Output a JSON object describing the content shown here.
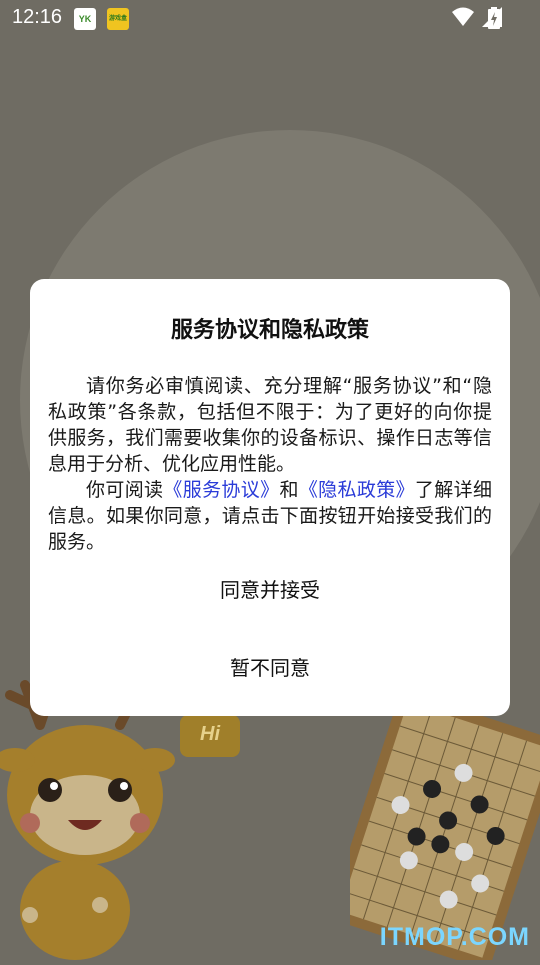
{
  "status_bar": {
    "time": "12:16",
    "app_icons": [
      {
        "name": "yk-app-icon",
        "label": "YK"
      },
      {
        "name": "game-app-icon",
        "label": "游戏盒"
      }
    ]
  },
  "dialog": {
    "title": "服务协议和隐私政策",
    "paragraph1": "请你务必审慎阅读、充分理解“服务协议”和“隐私政策”各条款，包括但不限于：为了更好的向你提供服务，我们需要收集你的设备标识、操作日志等信息用于分析、优化应用性能。",
    "p2_prefix": "你可阅读",
    "link_service": "《服务协议》",
    "p2_and": "和",
    "link_privacy": "《隐私政策》",
    "p2_suffix": "了解详细信息。如果你同意，请点击下面按钮开始接受我们的服务。",
    "agree_button": "同意并接受",
    "decline_button": "暂不同意"
  },
  "background": {
    "badge_text": "Hi",
    "watermark": "ITMOP.COM"
  },
  "colors": {
    "overlay": "#6f6c63",
    "link": "#2a3bd8",
    "watermark": "#7bd6ff"
  }
}
